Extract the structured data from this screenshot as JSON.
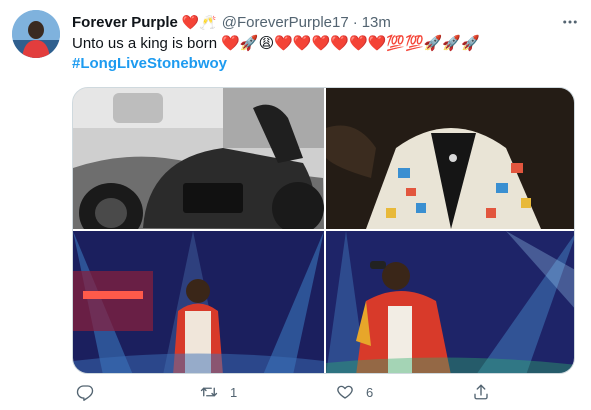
{
  "tweet": {
    "author": {
      "display_name": "Forever Purple",
      "name_emojis": "❤️🥂",
      "handle": "@ForeverPurple17",
      "separator": "·",
      "time": "13m"
    },
    "text": "Unto us a king is born",
    "text_emojis": "❤️🚀😩❤️❤️❤️❤️❤️❤️💯💯🚀🚀🚀",
    "hashtag": "#LongLiveStonebwoy",
    "media": [
      {
        "icon": "motorcycle-photo"
      },
      {
        "icon": "jacket-closeup-photo"
      },
      {
        "icon": "stage-performer-photo"
      },
      {
        "icon": "microphone-performer-photo"
      }
    ],
    "actions": {
      "reply_count": "",
      "retweet_count": "1",
      "like_count": "6",
      "share_count": ""
    }
  },
  "colors": {
    "link_blue": "#1d9bf0",
    "secondary_text": "#536471",
    "primary_text": "#0f1419"
  }
}
